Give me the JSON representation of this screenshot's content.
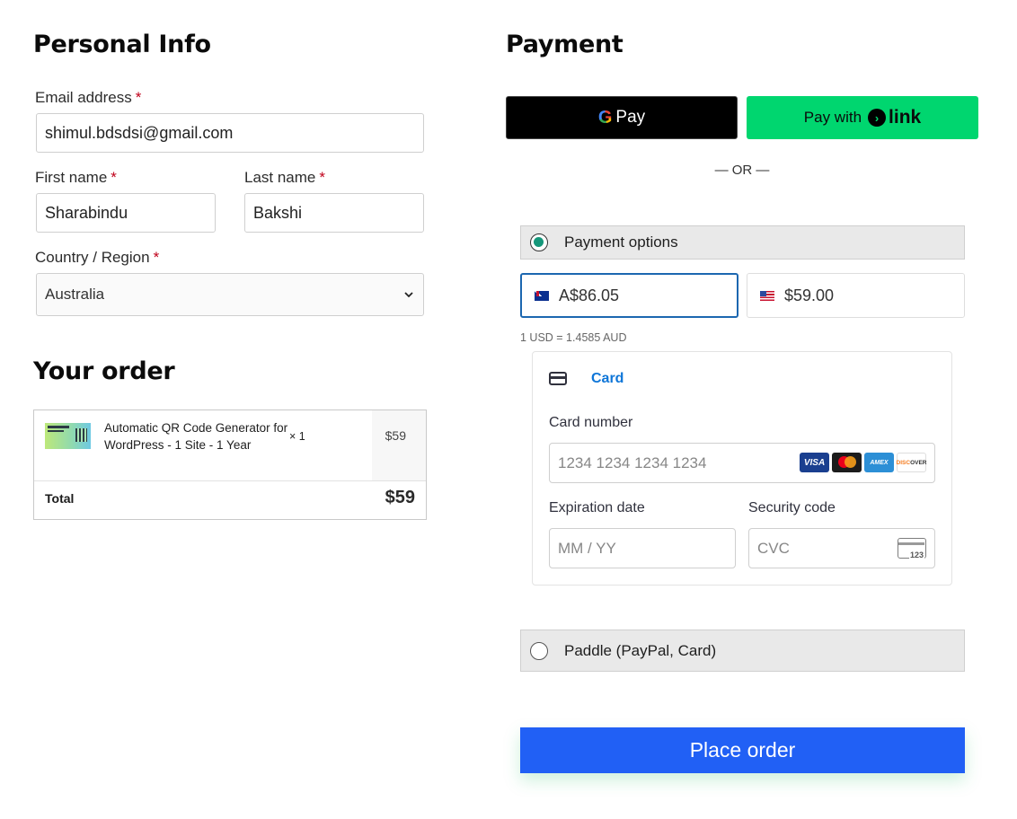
{
  "personal": {
    "heading": "Personal Info",
    "email_label": "Email address",
    "email_value": "shimul.bdsdsi@gmail.com",
    "first_name_label": "First name",
    "first_name_value": "Sharabindu",
    "last_name_label": "Last name",
    "last_name_value": "Bakshi",
    "country_label": "Country / Region",
    "country_value": "Australia",
    "required_mark": "*"
  },
  "order": {
    "heading": "Your order",
    "item_name": "Automatic QR Code Generator for WordPress - 1 Site - 1 Year",
    "item_qty": "× 1",
    "item_price": "$59",
    "total_label": "Total",
    "total_value": "$59"
  },
  "payment": {
    "heading": "Payment",
    "gpay_g": "G",
    "gpay_label": "Pay",
    "link_prefix": "Pay with",
    "link_brand": "link",
    "or_text": "— OR —",
    "option1_label": "Payment options",
    "currencies": [
      {
        "flag": "au-flag-icon",
        "amount": "A$86.05"
      },
      {
        "flag": "us-flag-icon",
        "amount": "$59.00"
      }
    ],
    "rate_text": "1 USD = 1.4585 AUD",
    "card_tab_label": "Card",
    "card_number_label": "Card number",
    "card_number_placeholder": "1234 1234 1234 1234",
    "expiry_label": "Expiration date",
    "expiry_placeholder": "MM / YY",
    "cvc_label": "Security code",
    "cvc_placeholder": "CVC",
    "cvc_icon_text": "123",
    "brands": [
      "VISA",
      "AMEX",
      "DISC",
      "OVER"
    ],
    "option2_label": "Paddle (PayPal, Card)",
    "place_order_label": "Place order"
  },
  "colors": {
    "accent": "#2160f5",
    "link_green": "#00d66f",
    "card_blue": "#0f76d8",
    "radio_selected": "#15977a"
  }
}
